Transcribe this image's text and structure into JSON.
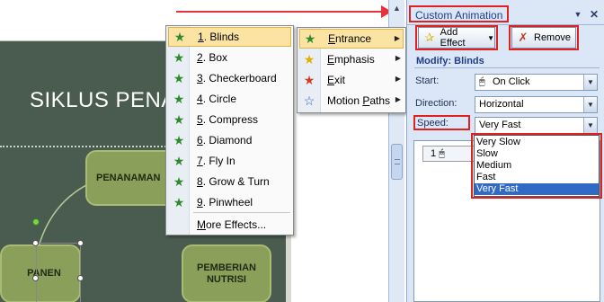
{
  "slide": {
    "title": "SIKLUS PENA",
    "nodes": {
      "penanaman": "PENANAMAN",
      "panen": "PANEN",
      "nutrisi": "PEMBERIAN\nNUTRISI"
    }
  },
  "effects_menu": {
    "items": [
      {
        "num": "1",
        "label": ". Blinds",
        "icon": "star-green-icon"
      },
      {
        "num": "2",
        "label": ". Box",
        "icon": "star-green-icon"
      },
      {
        "num": "3",
        "label": ". Checkerboard",
        "icon": "star-green-icon"
      },
      {
        "num": "4",
        "label": ". Circle",
        "icon": "star-green-icon"
      },
      {
        "num": "5",
        "label": ". Compress",
        "icon": "star-green-icon"
      },
      {
        "num": "6",
        "label": ". Diamond",
        "icon": "star-green-icon"
      },
      {
        "num": "7",
        "label": ". Fly In",
        "icon": "star-green-icon"
      },
      {
        "num": "8",
        "label": ". Grow & Turn",
        "icon": "star-green-icon"
      },
      {
        "num": "9",
        "label": ". Pinwheel",
        "icon": "star-green-icon"
      }
    ],
    "more_first": "M",
    "more_rest": "ore Effects..."
  },
  "submenu": {
    "items": [
      {
        "accel": "E",
        "rest": "ntrance",
        "icon": "entrance-star-icon",
        "color": "#2f8a2f"
      },
      {
        "accel": "E",
        "rest": "mphasis",
        "icon": "emphasis-star-icon",
        "color": "#e0b000"
      },
      {
        "accel": "E",
        "rest": "xit",
        "icon": "exit-star-icon",
        "color": "#d23a2a"
      },
      {
        "pre": "Motion ",
        "accel": "P",
        "rest": "aths",
        "icon": "motion-paths-star-icon",
        "color": "#2f5fbf"
      }
    ]
  },
  "pane": {
    "title": "Custom Animation",
    "add_effect": "Add Effect",
    "remove": "Remove",
    "modify_label": "Modify: Blinds",
    "start_label": "Start:",
    "start_value": "On Click",
    "direction_label": "Direction:",
    "direction_value": "Horizontal",
    "speed_label": "Speed:",
    "speed_value": "Very Fast",
    "effect_item_number": "1",
    "speed_options": [
      "Very Slow",
      "Slow",
      "Medium",
      "Fast",
      "Very Fast"
    ],
    "speed_selected_index": 4
  },
  "colors": {
    "annotation_red": "#e02121",
    "menu_highlight": "#fbe3a4",
    "selection_blue": "#316ac5",
    "slide_bg": "#4a5c4f"
  }
}
